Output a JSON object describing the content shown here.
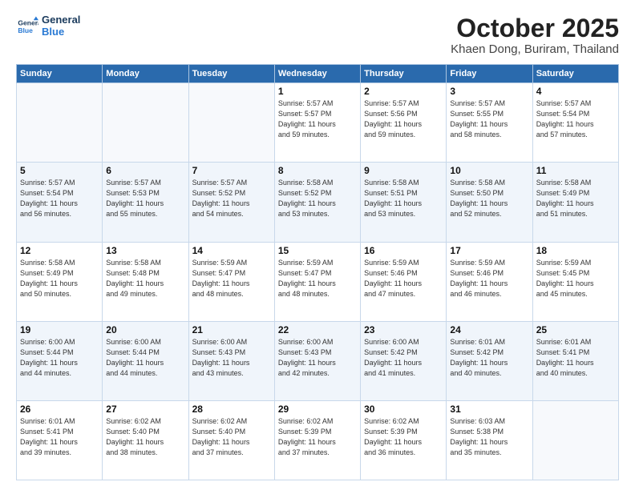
{
  "header": {
    "logo_line1": "General",
    "logo_line2": "Blue",
    "month": "October 2025",
    "location": "Khaen Dong, Buriram, Thailand"
  },
  "weekdays": [
    "Sunday",
    "Monday",
    "Tuesday",
    "Wednesday",
    "Thursday",
    "Friday",
    "Saturday"
  ],
  "weeks": [
    [
      {
        "day": "",
        "info": ""
      },
      {
        "day": "",
        "info": ""
      },
      {
        "day": "",
        "info": ""
      },
      {
        "day": "1",
        "info": "Sunrise: 5:57 AM\nSunset: 5:57 PM\nDaylight: 11 hours\nand 59 minutes."
      },
      {
        "day": "2",
        "info": "Sunrise: 5:57 AM\nSunset: 5:56 PM\nDaylight: 11 hours\nand 59 minutes."
      },
      {
        "day": "3",
        "info": "Sunrise: 5:57 AM\nSunset: 5:55 PM\nDaylight: 11 hours\nand 58 minutes."
      },
      {
        "day": "4",
        "info": "Sunrise: 5:57 AM\nSunset: 5:54 PM\nDaylight: 11 hours\nand 57 minutes."
      }
    ],
    [
      {
        "day": "5",
        "info": "Sunrise: 5:57 AM\nSunset: 5:54 PM\nDaylight: 11 hours\nand 56 minutes."
      },
      {
        "day": "6",
        "info": "Sunrise: 5:57 AM\nSunset: 5:53 PM\nDaylight: 11 hours\nand 55 minutes."
      },
      {
        "day": "7",
        "info": "Sunrise: 5:57 AM\nSunset: 5:52 PM\nDaylight: 11 hours\nand 54 minutes."
      },
      {
        "day": "8",
        "info": "Sunrise: 5:58 AM\nSunset: 5:52 PM\nDaylight: 11 hours\nand 53 minutes."
      },
      {
        "day": "9",
        "info": "Sunrise: 5:58 AM\nSunset: 5:51 PM\nDaylight: 11 hours\nand 53 minutes."
      },
      {
        "day": "10",
        "info": "Sunrise: 5:58 AM\nSunset: 5:50 PM\nDaylight: 11 hours\nand 52 minutes."
      },
      {
        "day": "11",
        "info": "Sunrise: 5:58 AM\nSunset: 5:49 PM\nDaylight: 11 hours\nand 51 minutes."
      }
    ],
    [
      {
        "day": "12",
        "info": "Sunrise: 5:58 AM\nSunset: 5:49 PM\nDaylight: 11 hours\nand 50 minutes."
      },
      {
        "day": "13",
        "info": "Sunrise: 5:58 AM\nSunset: 5:48 PM\nDaylight: 11 hours\nand 49 minutes."
      },
      {
        "day": "14",
        "info": "Sunrise: 5:59 AM\nSunset: 5:47 PM\nDaylight: 11 hours\nand 48 minutes."
      },
      {
        "day": "15",
        "info": "Sunrise: 5:59 AM\nSunset: 5:47 PM\nDaylight: 11 hours\nand 48 minutes."
      },
      {
        "day": "16",
        "info": "Sunrise: 5:59 AM\nSunset: 5:46 PM\nDaylight: 11 hours\nand 47 minutes."
      },
      {
        "day": "17",
        "info": "Sunrise: 5:59 AM\nSunset: 5:46 PM\nDaylight: 11 hours\nand 46 minutes."
      },
      {
        "day": "18",
        "info": "Sunrise: 5:59 AM\nSunset: 5:45 PM\nDaylight: 11 hours\nand 45 minutes."
      }
    ],
    [
      {
        "day": "19",
        "info": "Sunrise: 6:00 AM\nSunset: 5:44 PM\nDaylight: 11 hours\nand 44 minutes."
      },
      {
        "day": "20",
        "info": "Sunrise: 6:00 AM\nSunset: 5:44 PM\nDaylight: 11 hours\nand 44 minutes."
      },
      {
        "day": "21",
        "info": "Sunrise: 6:00 AM\nSunset: 5:43 PM\nDaylight: 11 hours\nand 43 minutes."
      },
      {
        "day": "22",
        "info": "Sunrise: 6:00 AM\nSunset: 5:43 PM\nDaylight: 11 hours\nand 42 minutes."
      },
      {
        "day": "23",
        "info": "Sunrise: 6:00 AM\nSunset: 5:42 PM\nDaylight: 11 hours\nand 41 minutes."
      },
      {
        "day": "24",
        "info": "Sunrise: 6:01 AM\nSunset: 5:42 PM\nDaylight: 11 hours\nand 40 minutes."
      },
      {
        "day": "25",
        "info": "Sunrise: 6:01 AM\nSunset: 5:41 PM\nDaylight: 11 hours\nand 40 minutes."
      }
    ],
    [
      {
        "day": "26",
        "info": "Sunrise: 6:01 AM\nSunset: 5:41 PM\nDaylight: 11 hours\nand 39 minutes."
      },
      {
        "day": "27",
        "info": "Sunrise: 6:02 AM\nSunset: 5:40 PM\nDaylight: 11 hours\nand 38 minutes."
      },
      {
        "day": "28",
        "info": "Sunrise: 6:02 AM\nSunset: 5:40 PM\nDaylight: 11 hours\nand 37 minutes."
      },
      {
        "day": "29",
        "info": "Sunrise: 6:02 AM\nSunset: 5:39 PM\nDaylight: 11 hours\nand 37 minutes."
      },
      {
        "day": "30",
        "info": "Sunrise: 6:02 AM\nSunset: 5:39 PM\nDaylight: 11 hours\nand 36 minutes."
      },
      {
        "day": "31",
        "info": "Sunrise: 6:03 AM\nSunset: 5:38 PM\nDaylight: 11 hours\nand 35 minutes."
      },
      {
        "day": "",
        "info": ""
      }
    ]
  ]
}
